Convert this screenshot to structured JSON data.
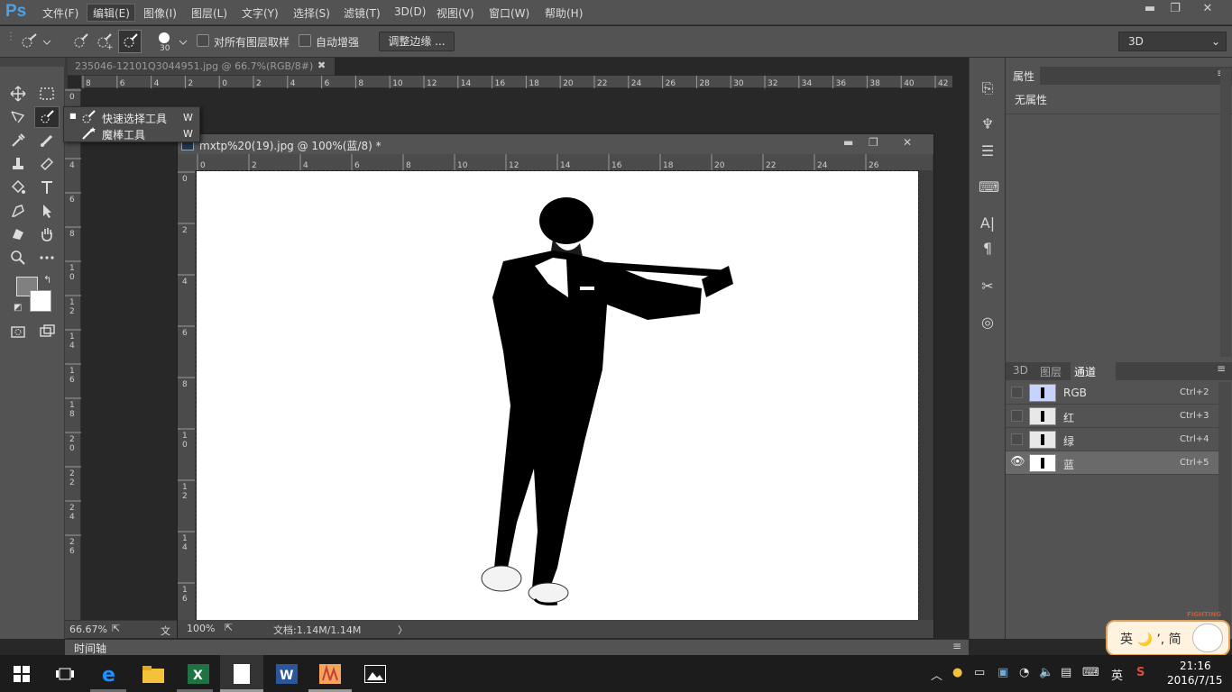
{
  "app": {
    "logo": "Ps"
  },
  "menu": [
    "文件(F)",
    "编辑(E)",
    "图像(I)",
    "图层(L)",
    "文字(Y)",
    "选择(S)",
    "滤镜(T)",
    "3D(D)",
    "视图(V)",
    "窗口(W)",
    "帮助(H)"
  ],
  "window_controls": {
    "minimize": "▬",
    "restore": "❐",
    "close": "✕"
  },
  "options": {
    "brush_size": "30",
    "sample_all_layers": "对所有图层取样",
    "auto_enhance": "自动增强",
    "refine_edge": "调整边缘 ...",
    "workspace": "3D"
  },
  "documents": {
    "tab1_title": "235046-12101Q3044951.jpg @ 66.7%(RGB/8#)",
    "tab1_close": "✖",
    "tab1_zoom": "66.67%",
    "tab1_status_cut": "文",
    "tab2_title": "mxtp%20(19).jpg @ 100%(蓝/8) *",
    "tab2_zoom": "100%",
    "tab2_doc": "文档:1.14M/1.14M",
    "tab2_arrow": "〉"
  },
  "rulers": {
    "top1": [
      "8",
      "6",
      "4",
      "2",
      "0",
      "2",
      "4",
      "6",
      "8",
      "10",
      "12",
      "14",
      "16",
      "18",
      "20",
      "22",
      "24",
      "26",
      "28",
      "30",
      "32",
      "34",
      "36",
      "38",
      "40",
      "42"
    ],
    "left1": [
      "0",
      "2",
      "4",
      "6",
      "8",
      "10",
      "12",
      "14",
      "16",
      "18",
      "20",
      "22",
      "24",
      "26"
    ],
    "top2": [
      "0",
      "2",
      "4",
      "6",
      "8",
      "10",
      "12",
      "14",
      "16",
      "18",
      "20",
      "22",
      "24",
      "26"
    ],
    "left2": [
      "0",
      "2",
      "4",
      "6",
      "8",
      "10",
      "12",
      "14",
      "16"
    ]
  },
  "flyout": [
    {
      "label": "快速选择工具",
      "key": "W"
    },
    {
      "label": "魔棒工具",
      "key": "W"
    }
  ],
  "timeline": {
    "label": "时间轴"
  },
  "properties": {
    "tab": "属性",
    "empty": "无属性"
  },
  "channels": {
    "tabs": [
      "3D",
      "图层",
      "通道"
    ],
    "rows": [
      {
        "name": "RGB",
        "shortcut": "Ctrl+2"
      },
      {
        "name": "红",
        "shortcut": "Ctrl+3"
      },
      {
        "name": "绿",
        "shortcut": "Ctrl+4"
      },
      {
        "name": "蓝",
        "shortcut": "Ctrl+5"
      }
    ]
  },
  "ime": {
    "text": "英 🌙 ’, 简",
    "sticker": "FIGHTING"
  },
  "taskbar": {
    "lang": "英",
    "time": "21:16",
    "date": "2016/7/15"
  },
  "colors": {
    "accent": "#4aa3e8",
    "ui_bg": "#535353",
    "dark_bg": "#282828"
  }
}
